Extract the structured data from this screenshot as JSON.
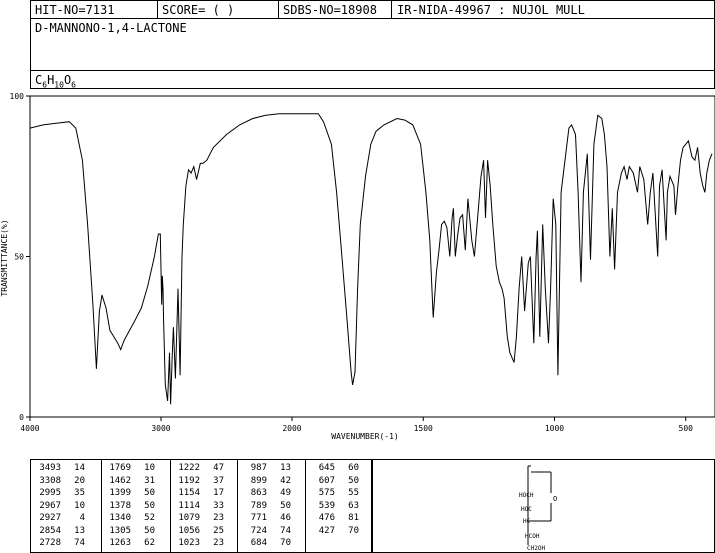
{
  "header": {
    "hit_no": "HIT-NO=7131",
    "score": "SCORE=  (   )",
    "sdbs_no": "SDBS-NO=18908",
    "ir_nida": "IR-NIDA-49967 : NUJOL MULL"
  },
  "compound": {
    "name": "D-MANNONO-1,4-LACTONE",
    "formula_parts": [
      "C",
      "6",
      "H",
      "10",
      "O",
      "6"
    ]
  },
  "chart_data": {
    "type": "line",
    "xlabel": "WAVENUMBER(-1)",
    "ylabel": "TRANSMITTANCE(%)",
    "xlim": [
      4000,
      400
    ],
    "ylim": [
      0,
      100
    ],
    "x_ticks": [
      4000,
      3000,
      2000,
      1500,
      1000,
      500
    ],
    "y_ticks": [
      0,
      50,
      100
    ],
    "x_tick_labels": [
      "4000",
      "3000",
      "2000",
      "1500",
      "1000",
      "500"
    ],
    "y_tick_labels": [
      "0",
      "50",
      "100"
    ],
    "series": [
      {
        "points": [
          [
            4000,
            90
          ],
          [
            3900,
            91
          ],
          [
            3800,
            91.5
          ],
          [
            3700,
            92
          ],
          [
            3650,
            90
          ],
          [
            3600,
            80
          ],
          [
            3560,
            60
          ],
          [
            3520,
            35
          ],
          [
            3493,
            15
          ],
          [
            3470,
            33
          ],
          [
            3450,
            38
          ],
          [
            3420,
            34
          ],
          [
            3390,
            27
          ],
          [
            3360,
            25
          ],
          [
            3330,
            23
          ],
          [
            3308,
            21
          ],
          [
            3280,
            24
          ],
          [
            3240,
            27
          ],
          [
            3200,
            30
          ],
          [
            3150,
            34
          ],
          [
            3100,
            41
          ],
          [
            3050,
            50
          ],
          [
            3020,
            57
          ],
          [
            3005,
            57
          ],
          [
            2995,
            35
          ],
          [
            2990,
            44
          ],
          [
            2985,
            40
          ],
          [
            2980,
            30
          ],
          [
            2967,
            10
          ],
          [
            2950,
            5
          ],
          [
            2935,
            20
          ],
          [
            2927,
            4
          ],
          [
            2915,
            18
          ],
          [
            2905,
            28
          ],
          [
            2890,
            12
          ],
          [
            2870,
            40
          ],
          [
            2854,
            13
          ],
          [
            2840,
            50
          ],
          [
            2830,
            60
          ],
          [
            2810,
            72
          ],
          [
            2790,
            77
          ],
          [
            2770,
            76
          ],
          [
            2750,
            78
          ],
          [
            2728,
            74
          ],
          [
            2700,
            79
          ],
          [
            2680,
            79
          ],
          [
            2650,
            80
          ],
          [
            2600,
            84
          ],
          [
            2500,
            88
          ],
          [
            2400,
            91
          ],
          [
            2300,
            93
          ],
          [
            2200,
            94
          ],
          [
            2100,
            94.5
          ],
          [
            2000,
            94.5
          ],
          [
            1900,
            94.5
          ],
          [
            1880,
            92
          ],
          [
            1850,
            85
          ],
          [
            1830,
            70
          ],
          [
            1810,
            50
          ],
          [
            1790,
            30
          ],
          [
            1775,
            14
          ],
          [
            1769,
            10
          ],
          [
            1760,
            14
          ],
          [
            1750,
            40
          ],
          [
            1740,
            60
          ],
          [
            1720,
            75
          ],
          [
            1700,
            85
          ],
          [
            1680,
            89
          ],
          [
            1650,
            91
          ],
          [
            1600,
            93
          ],
          [
            1570,
            92.5
          ],
          [
            1540,
            91
          ],
          [
            1510,
            85
          ],
          [
            1490,
            70
          ],
          [
            1475,
            55
          ],
          [
            1462,
            31
          ],
          [
            1450,
            45
          ],
          [
            1440,
            52
          ],
          [
            1430,
            60
          ],
          [
            1420,
            61
          ],
          [
            1410,
            59
          ],
          [
            1399,
            50
          ],
          [
            1390,
            62
          ],
          [
            1385,
            65
          ],
          [
            1378,
            50
          ],
          [
            1370,
            56
          ],
          [
            1360,
            62
          ],
          [
            1350,
            63
          ],
          [
            1340,
            52
          ],
          [
            1330,
            68
          ],
          [
            1315,
            55
          ],
          [
            1305,
            50
          ],
          [
            1290,
            65
          ],
          [
            1280,
            75
          ],
          [
            1270,
            80
          ],
          [
            1263,
            62
          ],
          [
            1255,
            80
          ],
          [
            1245,
            72
          ],
          [
            1235,
            60
          ],
          [
            1222,
            47
          ],
          [
            1210,
            42
          ],
          [
            1200,
            40
          ],
          [
            1192,
            37
          ],
          [
            1180,
            25
          ],
          [
            1170,
            20
          ],
          [
            1154,
            17
          ],
          [
            1145,
            25
          ],
          [
            1135,
            40
          ],
          [
            1125,
            50
          ],
          [
            1114,
            33
          ],
          [
            1100,
            48
          ],
          [
            1092,
            50
          ],
          [
            1079,
            23
          ],
          [
            1070,
            50
          ],
          [
            1065,
            58
          ],
          [
            1056,
            25
          ],
          [
            1045,
            60
          ],
          [
            1035,
            40
          ],
          [
            1023,
            23
          ],
          [
            1015,
            40
          ],
          [
            1005,
            68
          ],
          [
            995,
            60
          ],
          [
            987,
            13
          ],
          [
            975,
            70
          ],
          [
            960,
            80
          ],
          [
            945,
            90
          ],
          [
            935,
            91
          ],
          [
            920,
            88
          ],
          [
            910,
            70
          ],
          [
            899,
            42
          ],
          [
            890,
            70
          ],
          [
            875,
            82
          ],
          [
            863,
            49
          ],
          [
            850,
            85
          ],
          [
            835,
            94
          ],
          [
            820,
            93
          ],
          [
            810,
            88
          ],
          [
            800,
            78
          ],
          [
            789,
            50
          ],
          [
            780,
            65
          ],
          [
            771,
            46
          ],
          [
            760,
            70
          ],
          [
            745,
            76
          ],
          [
            735,
            78
          ],
          [
            724,
            74
          ],
          [
            715,
            78
          ],
          [
            700,
            76
          ],
          [
            684,
            70
          ],
          [
            675,
            78
          ],
          [
            660,
            74
          ],
          [
            645,
            60
          ],
          [
            635,
            70
          ],
          [
            625,
            76
          ],
          [
            607,
            50
          ],
          [
            600,
            72
          ],
          [
            590,
            77
          ],
          [
            575,
            55
          ],
          [
            570,
            70
          ],
          [
            560,
            75
          ],
          [
            545,
            72
          ],
          [
            539,
            63
          ],
          [
            530,
            72
          ],
          [
            520,
            80
          ],
          [
            510,
            84
          ],
          [
            500,
            85
          ],
          [
            490,
            86
          ],
          [
            476,
            81
          ],
          [
            465,
            80
          ],
          [
            455,
            84
          ],
          [
            445,
            76
          ],
          [
            435,
            72
          ],
          [
            427,
            70
          ],
          [
            420,
            76
          ],
          [
            410,
            80
          ],
          [
            400,
            82
          ]
        ]
      }
    ]
  },
  "peak_table": {
    "columns": [
      [
        [
          "3493",
          "14"
        ],
        [
          "3308",
          "20"
        ],
        [
          "2995",
          "35"
        ],
        [
          "2967",
          "10"
        ],
        [
          "2927",
          "4"
        ],
        [
          "2854",
          "13"
        ],
        [
          "2728",
          "74"
        ]
      ],
      [
        [
          "1769",
          "10"
        ],
        [
          "1462",
          "31"
        ],
        [
          "1399",
          "50"
        ],
        [
          "1378",
          "50"
        ],
        [
          "1340",
          "52"
        ],
        [
          "1305",
          "50"
        ],
        [
          "1263",
          "62"
        ]
      ],
      [
        [
          "1222",
          "47"
        ],
        [
          "1192",
          "37"
        ],
        [
          "1154",
          "17"
        ],
        [
          "1114",
          "33"
        ],
        [
          "1079",
          "23"
        ],
        [
          "1056",
          "25"
        ],
        [
          "1023",
          "23"
        ]
      ],
      [
        [
          "987",
          "13"
        ],
        [
          "899",
          "42"
        ],
        [
          "863",
          "49"
        ],
        [
          "789",
          "50"
        ],
        [
          "771",
          "46"
        ],
        [
          "724",
          "74"
        ],
        [
          "684",
          "70"
        ]
      ],
      [
        [
          "645",
          "60"
        ],
        [
          "607",
          "50"
        ],
        [
          "575",
          "55"
        ],
        [
          "539",
          "63"
        ],
        [
          "476",
          "81"
        ],
        [
          "427",
          "70"
        ]
      ]
    ]
  },
  "structure": {
    "labels": [
      "HOCH",
      "HOC",
      "HC",
      "HCOH",
      "CH2OH"
    ],
    "ring_o": "O"
  }
}
